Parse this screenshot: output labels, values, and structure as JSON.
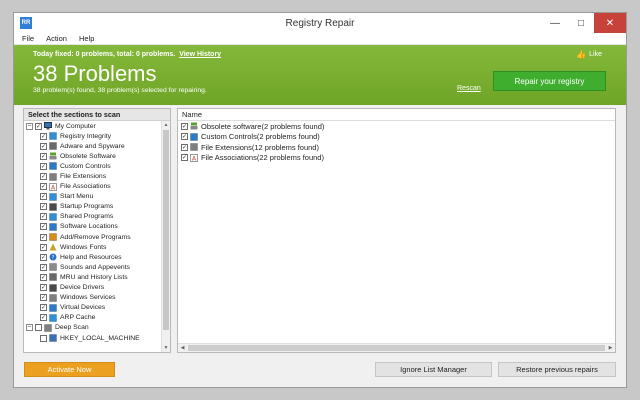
{
  "window": {
    "title": "Registry Repair",
    "app_icon_text": "RR"
  },
  "menu": [
    "File",
    "Action",
    "Help"
  ],
  "banner": {
    "fixed_text": "Today fixed: 0 problems, total: 0 problems.",
    "view_history": "View History",
    "title": "38 Problems",
    "subtitle": "38 problem(s) found, 38 problem(s) selected for repairing.",
    "like": "Like",
    "rescan": "Rescan",
    "repair_button": "Repair your registry"
  },
  "left_panel": {
    "header": "Select the sections to scan",
    "tree": [
      {
        "label": "My Computer",
        "level": "root",
        "checked": true,
        "icon": "computer-icon"
      },
      {
        "label": "Registry Integrity",
        "level": "child",
        "checked": true,
        "icon": "grid-icon"
      },
      {
        "label": "Adware and Spyware",
        "level": "child",
        "checked": true,
        "icon": "spyware-icon"
      },
      {
        "label": "Obsolete Software",
        "level": "child",
        "checked": true,
        "icon": "software-icon"
      },
      {
        "label": "Custom Controls",
        "level": "child",
        "checked": true,
        "icon": "controls-icon"
      },
      {
        "label": "File Extensions",
        "level": "child",
        "checked": true,
        "icon": "file-icon"
      },
      {
        "label": "File Associations",
        "level": "child",
        "checked": true,
        "icon": "association-icon"
      },
      {
        "label": "Start Menu",
        "level": "child",
        "checked": true,
        "icon": "start-menu-icon"
      },
      {
        "label": "Startup Programs",
        "level": "child",
        "checked": true,
        "icon": "startup-icon"
      },
      {
        "label": "Shared Programs",
        "level": "child",
        "checked": true,
        "icon": "shared-icon"
      },
      {
        "label": "Software Locations",
        "level": "child",
        "checked": true,
        "icon": "locations-icon"
      },
      {
        "label": "Add/Remove Programs",
        "level": "child",
        "checked": true,
        "icon": "add-remove-icon"
      },
      {
        "label": "Windows Fonts",
        "level": "child",
        "checked": true,
        "icon": "fonts-icon"
      },
      {
        "label": "Help and Resources",
        "level": "child",
        "checked": true,
        "icon": "help-icon"
      },
      {
        "label": "Sounds and Appevents",
        "level": "child",
        "checked": true,
        "icon": "sound-icon"
      },
      {
        "label": "MRU and History Lists",
        "level": "child",
        "checked": true,
        "icon": "history-icon"
      },
      {
        "label": "Device Drivers",
        "level": "child",
        "checked": true,
        "icon": "driver-icon"
      },
      {
        "label": "Windows Services",
        "level": "child",
        "checked": true,
        "icon": "services-icon"
      },
      {
        "label": "Virtual Devices",
        "level": "child",
        "checked": true,
        "icon": "virtual-icon"
      },
      {
        "label": "ARP Cache",
        "level": "child",
        "checked": true,
        "icon": "arp-icon"
      },
      {
        "label": "Deep Scan",
        "level": "root",
        "checked": false,
        "icon": "deep-scan-icon"
      },
      {
        "label": "HKEY_LOCAL_MACHINE",
        "level": "sub",
        "checked": false,
        "icon": "hive-icon"
      }
    ]
  },
  "right_panel": {
    "column_header": "Name",
    "items": [
      {
        "label": "Obsolete software(2 problems found)",
        "checked": true,
        "icon": "software-icon"
      },
      {
        "label": "Custom Controls(2 problems found)",
        "checked": true,
        "icon": "controls-icon"
      },
      {
        "label": "File Extensions(12 problems found)",
        "checked": true,
        "icon": "file-icon"
      },
      {
        "label": "File Associations(22 problems found)",
        "checked": true,
        "icon": "association-icon"
      }
    ]
  },
  "footer": {
    "activate": "Activate Now",
    "ignore_list": "Ignore List Manager",
    "restore": "Restore previous repairs"
  },
  "colors": {
    "banner_green": "#7ab032",
    "repair_green": "#3fae2f",
    "activate_orange": "#eba020",
    "close_red": "#c7423a"
  }
}
